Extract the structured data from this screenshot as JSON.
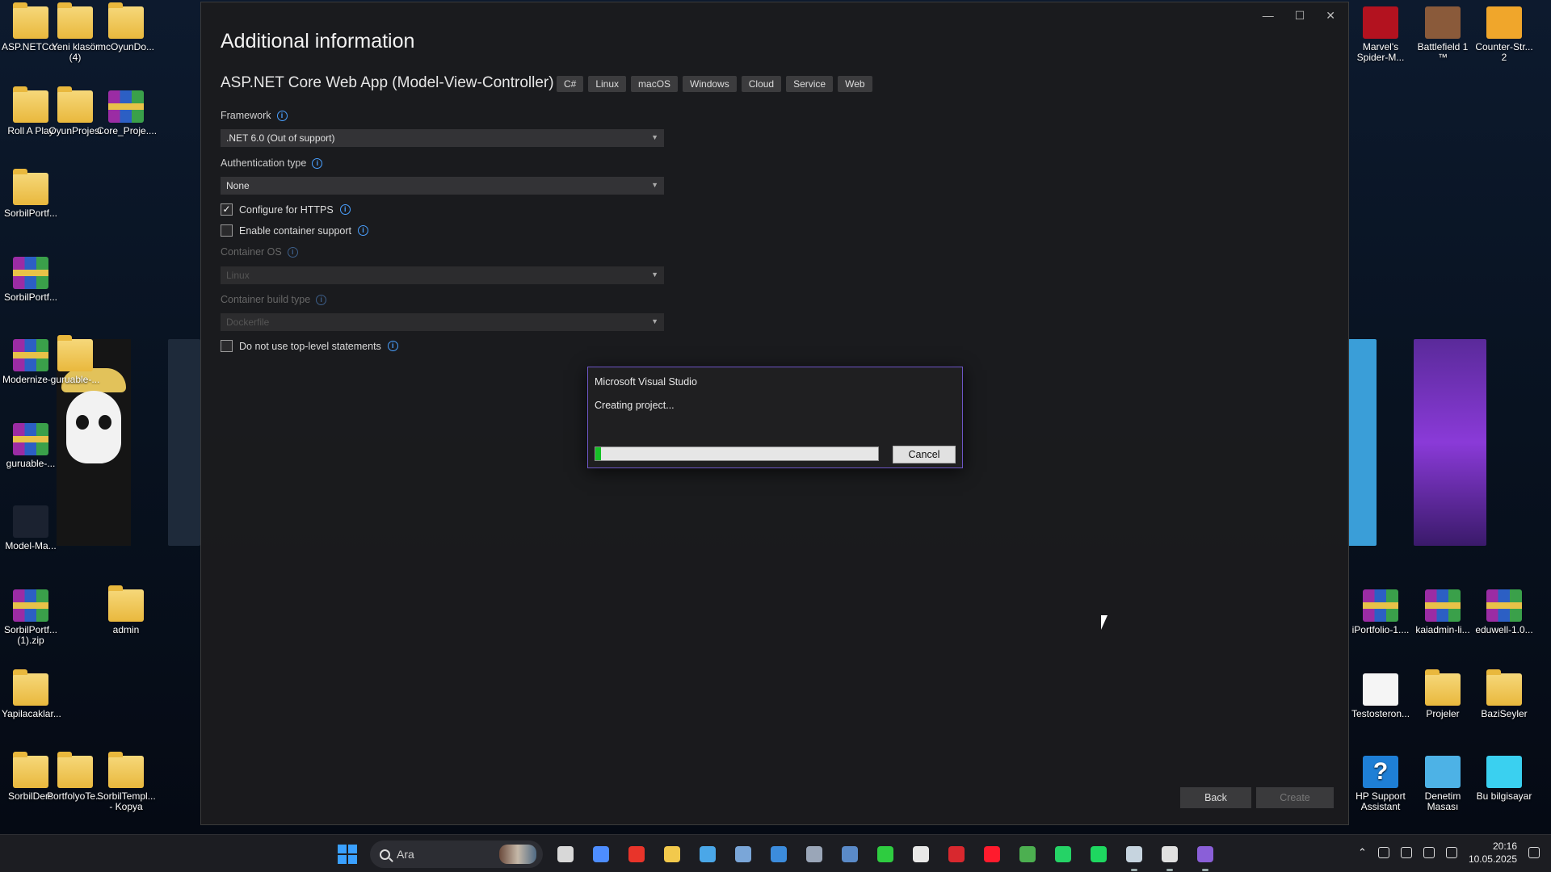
{
  "desktop": {
    "icons_left": [
      {
        "label": "ASP.NETCo...",
        "type": "folder"
      },
      {
        "label": "Yeni klasör (4)",
        "type": "folder"
      },
      {
        "label": "mcOyunDo...",
        "type": "folder"
      },
      {
        "label": "Roll A Play",
        "type": "folder"
      },
      {
        "label": "OyunProjesi",
        "type": "folder"
      },
      {
        "label": "Core_Proje....",
        "type": "rar"
      },
      {
        "label": "SorbilPortf...",
        "type": "folder"
      },
      {
        "label": "SorbilPortf...",
        "type": "rar"
      },
      {
        "label": "Modernize-...",
        "type": "rar"
      },
      {
        "label": "guruable-...",
        "type": "folder"
      },
      {
        "label": "guruable-...",
        "type": "rar"
      },
      {
        "label": "Model-Ma...",
        "type": "person"
      },
      {
        "label": "SorbilPortf... (1).zip",
        "type": "rar"
      },
      {
        "label": "admin",
        "type": "folder"
      },
      {
        "label": "Yapilacaklar...",
        "type": "folder"
      },
      {
        "label": "SorbilDers",
        "type": "folder"
      },
      {
        "label": "PortfolyoTe...",
        "type": "folder"
      },
      {
        "label": "SorbilTempl... - Kopya",
        "type": "folder"
      }
    ],
    "icons_right": [
      {
        "label": "Marvel's Spider-M...",
        "type": "red"
      },
      {
        "label": "Battlefield 1 ™",
        "type": "bf"
      },
      {
        "label": "Counter-Str... 2",
        "type": "cs"
      },
      {
        "label": "iPortfolio-1....",
        "type": "rar"
      },
      {
        "label": "kaiadmin-li...",
        "type": "rar"
      },
      {
        "label": "eduwell-1.0...",
        "type": "rar"
      },
      {
        "label": "Testosteron...",
        "type": "testo"
      },
      {
        "label": "Projeler",
        "type": "folder"
      },
      {
        "label": "BaziSeyler",
        "type": "folder"
      },
      {
        "label": "HP Support Assistant",
        "type": "help"
      },
      {
        "label": "Denetim Masası",
        "type": "panel"
      },
      {
        "label": "Bu bilgisayar",
        "type": "pc"
      }
    ]
  },
  "vs": {
    "title": "Additional information",
    "project_title": "ASP.NET Core Web App (Model-View-Controller)",
    "tags": [
      "C#",
      "Linux",
      "macOS",
      "Windows",
      "Cloud",
      "Service",
      "Web"
    ],
    "framework_label": "Framework",
    "framework_value": ".NET 6.0 (Out of support)",
    "auth_label": "Authentication type",
    "auth_value": "None",
    "https_label": "Configure for HTTPS",
    "https_checked": "✓",
    "container_label": "Enable container support",
    "container_os_label": "Container OS",
    "container_os_value": "Linux",
    "container_build_label": "Container build type",
    "container_build_value": "Dockerfile",
    "toplevel_label": "Do not use top-level statements",
    "back_label": "Back",
    "create_label": "Create"
  },
  "dialog": {
    "title": "Microsoft Visual Studio",
    "message": "Creating project...",
    "progress_percent": 2,
    "cancel_label": "Cancel"
  },
  "taskbar": {
    "search_placeholder": "Ara",
    "apps": [
      {
        "name": "task-view",
        "color": "#d8d8d8"
      },
      {
        "name": "copilot",
        "color": "#4d8dff"
      },
      {
        "name": "app-red",
        "color": "#e8342a"
      },
      {
        "name": "file-explorer",
        "color": "#f2c94c"
      },
      {
        "name": "app-blue",
        "color": "#4aa7e8"
      },
      {
        "name": "photos",
        "color": "#7aa6d8"
      },
      {
        "name": "store",
        "color": "#3c8cdc"
      },
      {
        "name": "settings",
        "color": "#9aa6b8"
      },
      {
        "name": "app-monitor",
        "color": "#5a8ac8"
      },
      {
        "name": "xbox",
        "color": "#2ecc40"
      },
      {
        "name": "app-white",
        "color": "#e8e8e8"
      },
      {
        "name": "app-red2",
        "color": "#d8282e"
      },
      {
        "name": "opera",
        "color": "#ff1b2d"
      },
      {
        "name": "chrome",
        "color": "#4caf50"
      },
      {
        "name": "whatsapp",
        "color": "#25d366"
      },
      {
        "name": "spotify",
        "color": "#1ed760"
      },
      {
        "name": "steam",
        "color": "#c6d4df"
      },
      {
        "name": "unity",
        "color": "#e0e0e0"
      },
      {
        "name": "visual-studio",
        "color": "#8a5fd8"
      }
    ],
    "time": "20:16",
    "date": "10.05.2025"
  }
}
